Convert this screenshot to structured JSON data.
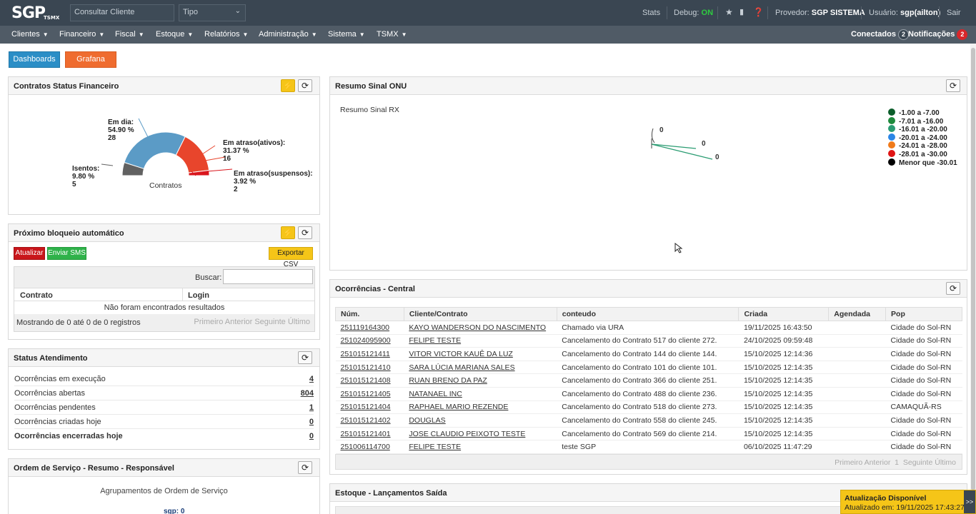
{
  "topbar": {
    "logo": "SGP",
    "logo_sub": "TSMX",
    "search_placeholder": "Consultar Cliente",
    "type_select": "Tipo",
    "stats": "Stats",
    "debug_label": "Debug:",
    "debug_value": "ON",
    "provider_label": "Provedor:",
    "provider_value": "SGP SISTEMA",
    "user_label": "Usuário:",
    "user_value": "sgp(ailton)",
    "logout": "Sair"
  },
  "nav": {
    "items": [
      "Clientes",
      "Financeiro",
      "Fiscal",
      "Estoque",
      "Relatórios",
      "Administração",
      "Sistema",
      "TSMX"
    ],
    "connected_label": "Conectados",
    "connected_count": "2",
    "notifications_label": "Notificações",
    "notifications_count": "2"
  },
  "buttons": {
    "dashboards": "Dashboards",
    "grafana": "Grafana"
  },
  "contracts_panel": {
    "title": "Contratos Status Financeiro",
    "center_label": "Contratos",
    "chart_data": {
      "type": "pie",
      "title": "",
      "center": "Contratos",
      "slices": [
        {
          "label": "Em dia:",
          "percent": "54.90 %",
          "count": "28",
          "value": 54.9,
          "color": "#5b9bc6"
        },
        {
          "label": "Em atraso(ativos):",
          "percent": "31.37 %",
          "count": "16",
          "value": 31.37,
          "color": "#e8452c"
        },
        {
          "label": "Em atraso(suspensos):",
          "percent": "3.92 %",
          "count": "2",
          "value": 3.92,
          "color": "#d9161d"
        },
        {
          "label": "Isentos:",
          "percent": "9.80 %",
          "count": "5",
          "value": 9.8,
          "color": "#616161"
        }
      ]
    }
  },
  "block_panel": {
    "title": "Próximo bloqueio automático",
    "btn_update": "Atualizar",
    "btn_sms": "Enviar SMS",
    "btn_csv": "Exportar CSV",
    "search_label": "Buscar:",
    "col_contract": "Contrato",
    "col_login": "Login",
    "empty": "Não foram encontrados resultados",
    "info": "Mostrando de 0 até 0 de 0 registros",
    "pagination": "Primeiro Anterior Seguinte Último"
  },
  "status_panel": {
    "title": "Status Atendimento",
    "rows": [
      {
        "label": "Ocorrências em execução",
        "value": "4"
      },
      {
        "label": "Ocorrências abertas",
        "value": "804"
      },
      {
        "label": "Ocorrências pendentes",
        "value": "1"
      },
      {
        "label": "Ocorrências criadas hoje",
        "value": "0"
      },
      {
        "label": "Ocorrências encerradas hoje",
        "value": "0"
      }
    ]
  },
  "os_panel": {
    "title": "Ordem de Serviço - Resumo - Responsável",
    "subtitle": "Agrupamentos de Ordem de Serviço",
    "partial_label": "sgp: 0"
  },
  "onu_panel": {
    "title": "Resumo Sinal ONU",
    "subtitle": "Resumo Sinal RX",
    "point_labels": [
      "0",
      "0",
      "0"
    ],
    "legend": [
      {
        "label": "-1.00 a -7.00",
        "color": "#0b5d2a"
      },
      {
        "label": "-7.01 a -16.00",
        "color": "#1e8a3c"
      },
      {
        "label": "-16.01 a -20.00",
        "color": "#2a9c72"
      },
      {
        "label": "-20.01 a -24.00",
        "color": "#2b86e6"
      },
      {
        "label": "-24.01 a -28.00",
        "color": "#f07a1a"
      },
      {
        "label": "-28.01 a -30.00",
        "color": "#e01414"
      },
      {
        "label": "Menor que -30.01",
        "color": "#000000"
      }
    ]
  },
  "occ_panel": {
    "title": "Ocorrências - Central",
    "columns": [
      "Núm.",
      "Cliente/Contrato",
      "conteudo",
      "Criada",
      "Agendada",
      "Pop"
    ],
    "rows": [
      [
        "251119164300",
        "KAYO WANDERSON DO NASCIMENTO",
        "Chamado via URA",
        "19/11/2025 16:43:50",
        "",
        "Cidade do Sol-RN"
      ],
      [
        "251024095900",
        "FELIPE TESTE",
        "Cancelamento do Contrato 517 do cliente 272.",
        "24/10/2025 09:59:48",
        "",
        "Cidade do Sol-RN"
      ],
      [
        "251015121411",
        "VITOR VICTOR KAUÊ DA LUZ",
        "Cancelamento do Contrato 144 do cliente 144.",
        "15/10/2025 12:14:36",
        "",
        "Cidade do Sol-RN"
      ],
      [
        "251015121410",
        "SARA LÚCIA MARIANA SALES",
        "Cancelamento do Contrato 101 do cliente 101.",
        "15/10/2025 12:14:35",
        "",
        "Cidade do Sol-RN"
      ],
      [
        "251015121408",
        "RUAN BRENO DA PAZ",
        "Cancelamento do Contrato 366 do cliente 251.",
        "15/10/2025 12:14:35",
        "",
        "Cidade do Sol-RN"
      ],
      [
        "251015121405",
        "NATANAEL INC",
        "Cancelamento do Contrato 488 do cliente 236.",
        "15/10/2025 12:14:35",
        "",
        "Cidade do Sol-RN"
      ],
      [
        "251015121404",
        "RAPHAEL MARIO REZENDE",
        "Cancelamento do Contrato 518 do cliente 273.",
        "15/10/2025 12:14:35",
        "",
        "CAMAQUÃ-RS"
      ],
      [
        "251015121402",
        "DOUGLAS",
        "Cancelamento do Contrato 558 do cliente 245.",
        "15/10/2025 12:14:35",
        "",
        "Cidade do Sol-RN"
      ],
      [
        "251015121401",
        "JOSE CLAUDIO PEIXOTO TESTE",
        "Cancelamento do Contrato 569 do cliente 214.",
        "15/10/2025 12:14:35",
        "",
        "Cidade do Sol-RN"
      ],
      [
        "251006114700",
        "FELIPE TESTE",
        "teste SGP",
        "06/10/2025 11:47:29",
        "",
        "Cidade do Sol-RN"
      ]
    ],
    "pagination": {
      "first": "Primeiro",
      "prev": "Anterior",
      "page": "1",
      "next": "Seguinte",
      "last": "Último"
    }
  },
  "stock_panel": {
    "title": "Estoque - Lançamentos Saída"
  },
  "update_toast": {
    "title": "Atualização Disponível",
    "subtitle": "Atualizado em: 19/11/2025 17:43:27",
    "arrow": ">>"
  }
}
